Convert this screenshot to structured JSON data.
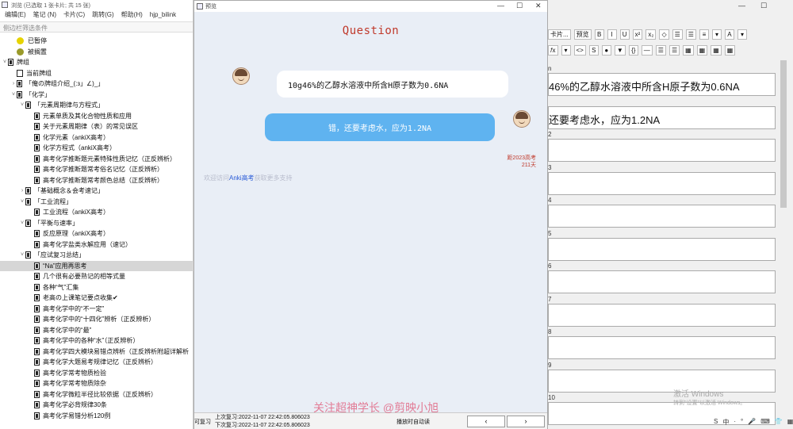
{
  "browser": {
    "title": "浏览 (已选取 1 张卡片; 共 15 张)",
    "menu": [
      "编辑(E)",
      "笔记 (N)",
      "卡片(C)",
      "跳转(G)",
      "帮助(H)",
      "hjp_bilink"
    ],
    "filter_placeholder": "侧边栏筛选条件",
    "tree": [
      {
        "label": "已暂停",
        "type": "dot-yellow",
        "indent": 1,
        "arrow": ""
      },
      {
        "label": "被搁置",
        "type": "dot-olive",
        "indent": 1,
        "arrow": ""
      },
      {
        "label": "牌组",
        "type": "deck",
        "indent": 0,
        "arrow": "˅"
      },
      {
        "label": "当前牌组",
        "type": "current",
        "indent": 1,
        "arrow": ""
      },
      {
        "label": "「俺の牌组介绍_(:з」∠)_」",
        "type": "deck",
        "indent": 1,
        "arrow": "›"
      },
      {
        "label": "「化学」",
        "type": "deck",
        "indent": 1,
        "arrow": "˅"
      },
      {
        "label": "「元素周期律与方程式」",
        "type": "deck",
        "indent": 2,
        "arrow": "˅"
      },
      {
        "label": "元素单质及其化合物性质和应用",
        "type": "deck",
        "indent": 3,
        "arrow": ""
      },
      {
        "label": "关于元素周期律（表）的常见误区",
        "type": "deck",
        "indent": 3,
        "arrow": ""
      },
      {
        "label": "化学元素（ankiX高考）",
        "type": "deck",
        "indent": 3,
        "arrow": ""
      },
      {
        "label": "化学方程式（ankiX高考）",
        "type": "deck",
        "indent": 3,
        "arrow": ""
      },
      {
        "label": "高考化学推断题元素特殊性质记忆（正反辨析）",
        "type": "deck",
        "indent": 3,
        "arrow": ""
      },
      {
        "label": "高考化学推断题常考俗名记忆（正反辨析）",
        "type": "deck",
        "indent": 3,
        "arrow": ""
      },
      {
        "label": "高考化学推断题常考颜色总结（正反辨析）",
        "type": "deck",
        "indent": 3,
        "arrow": ""
      },
      {
        "label": "「基础概念＆会考速记」",
        "type": "deck",
        "indent": 2,
        "arrow": "›"
      },
      {
        "label": "「工业流程」",
        "type": "deck",
        "indent": 2,
        "arrow": "˅"
      },
      {
        "label": "工业流程（ankiX高考）",
        "type": "deck",
        "indent": 3,
        "arrow": ""
      },
      {
        "label": "「平衡与速率」",
        "type": "deck",
        "indent": 2,
        "arrow": "˅"
      },
      {
        "label": "反应原理（ankiX高考）",
        "type": "deck",
        "indent": 3,
        "arrow": ""
      },
      {
        "label": "高考化学盐类水解应用（速记）",
        "type": "deck",
        "indent": 3,
        "arrow": ""
      },
      {
        "label": "「应试复习总结」",
        "type": "deck",
        "indent": 2,
        "arrow": "˅"
      },
      {
        "label": "“Na”应用再思考",
        "type": "deck",
        "indent": 3,
        "arrow": "",
        "selected": true
      },
      {
        "label": "几个很有必要熟记的相等式量",
        "type": "deck",
        "indent": 3,
        "arrow": ""
      },
      {
        "label": "各种“气”汇集",
        "type": "deck",
        "indent": 3,
        "arrow": ""
      },
      {
        "label": "老高の上课笔记要点收集✔",
        "type": "deck",
        "indent": 3,
        "arrow": ""
      },
      {
        "label": "高考化学中的“不一定”",
        "type": "deck",
        "indent": 3,
        "arrow": ""
      },
      {
        "label": "高考化学中的“十四化”辨析（正反辨析）",
        "type": "deck",
        "indent": 3,
        "arrow": ""
      },
      {
        "label": "高考化学中的“最”",
        "type": "deck",
        "indent": 3,
        "arrow": ""
      },
      {
        "label": "高考化学中的各种“水”（正反辨析）",
        "type": "deck",
        "indent": 3,
        "arrow": ""
      },
      {
        "label": "高考化学四大模块易错点辨析（正反辨析附超详解析",
        "type": "deck",
        "indent": 3,
        "arrow": ""
      },
      {
        "label": "高考化学大题易考规律记忆（正反辨析）",
        "type": "deck",
        "indent": 3,
        "arrow": ""
      },
      {
        "label": "高考化学常考物质检验",
        "type": "deck",
        "indent": 3,
        "arrow": ""
      },
      {
        "label": "高考化学常考物质除杂",
        "type": "deck",
        "indent": 3,
        "arrow": ""
      },
      {
        "label": "高考化学微粒半径比较依据（正反辨析）",
        "type": "deck",
        "indent": 3,
        "arrow": ""
      },
      {
        "label": "高考化学必背规律30条",
        "type": "deck",
        "indent": 3,
        "arrow": ""
      },
      {
        "label": "高考化学易错分析120例",
        "type": "deck",
        "indent": 3,
        "arrow": ""
      }
    ]
  },
  "preview": {
    "title": "预览",
    "window_controls": [
      "—",
      "☐",
      "✕"
    ],
    "heading": "Question",
    "question_text": "10g46%的乙醇水溶液中所含H原子数为0.6NA",
    "answer_text": "错，还要考虑水，应为1.2NA",
    "countdown_line1": "距2023高考",
    "countdown_line2": "211天",
    "faded_prefix": "欢迎访问",
    "faded_link": "Anki高考",
    "faded_suffix": "获取更多支持",
    "watermark": "关注超神学长 @剪映小旭",
    "footer_label": "可复习",
    "last_review": "上次复习:2022-11-07 22:42:05.806023",
    "next_review": "下次复习:2022-11-07 22:42:05.806023",
    "mid_text": "播放时自动读",
    "prev_button": "‹",
    "next_button": "›"
  },
  "editor": {
    "window_controls": [
      "—",
      "☐"
    ],
    "toolbar1": [
      "卡片...",
      "预览",
      "B",
      "I",
      "U",
      "x²",
      "x₂",
      "◇",
      "☰",
      "☰",
      "≡",
      "▾",
      "A",
      "▾"
    ],
    "toolbar2": [
      "𝑓x",
      "▾",
      "<>",
      "S",
      "●",
      "▼",
      "{}",
      "—",
      "☰",
      "☰",
      "▦",
      "▦",
      "▦",
      "▦"
    ],
    "fields": [
      {
        "name": "n",
        "value": "46%的乙醇水溶液中所含H原子数为0.6NA"
      },
      {
        "name": "",
        "value": "还要考虑水，应为1.2NA"
      },
      {
        "name": "2",
        "value": ""
      },
      {
        "name": "3",
        "value": ""
      },
      {
        "name": "4",
        "value": ""
      },
      {
        "name": "5",
        "value": ""
      },
      {
        "name": "6",
        "value": ""
      },
      {
        "name": "7",
        "value": ""
      },
      {
        "name": "8",
        "value": ""
      },
      {
        "name": "9",
        "value": ""
      },
      {
        "name": "10",
        "value": ""
      }
    ],
    "activation_title": "激活 Windows",
    "activation_sub": "转到\"设置\"以激活 Windows。",
    "taskbar": [
      "S",
      "中",
      "·",
      "°",
      "🎤",
      "⌨",
      "👕",
      "▦"
    ]
  }
}
